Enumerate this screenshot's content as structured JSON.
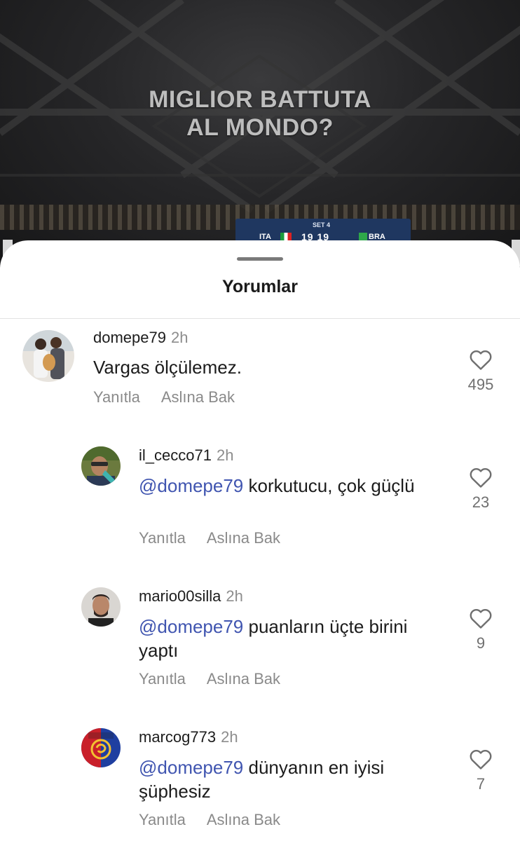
{
  "video": {
    "caption_lines": [
      "MIGLIOR BATTUTA",
      "AL MONDO?"
    ],
    "scoreboard": {
      "set_label": "SET 4",
      "score": "19 19",
      "team_left": "ITA",
      "team_right": "BRA"
    }
  },
  "sheet": {
    "title": "Yorumlar"
  },
  "comments": [
    {
      "username": "domepe79",
      "time": "2h",
      "mention": "",
      "text": "Vargas ölçülemez.",
      "reply_label": "Yanıtla",
      "translate_label": "Aslına Bak",
      "likes": "495"
    },
    {
      "username": "il_cecco71",
      "time": "2h",
      "mention": "@domepe79",
      "text": "korkutucu, çok güçlü",
      "reply_label": "Yanıtla",
      "translate_label": "Aslına Bak",
      "likes": "23"
    },
    {
      "username": "mario00silla",
      "time": "2h",
      "mention": "@domepe79",
      "text": "puanların üçte birini yaptı",
      "reply_label": "Yanıtla",
      "translate_label": "Aslına Bak",
      "likes": "9"
    },
    {
      "username": "marcog773",
      "time": "2h",
      "mention": "@domepe79",
      "text": "dünyanın en iyisi şüphesiz",
      "reply_label": "Yanıtla",
      "translate_label": "Aslına Bak",
      "likes": "7"
    }
  ],
  "icons": {
    "like": "heart-outline-icon"
  },
  "colors": {
    "mention": "#4055b0",
    "secondary_text": "#8a8a8a",
    "sheet_background": "#ffffff"
  }
}
